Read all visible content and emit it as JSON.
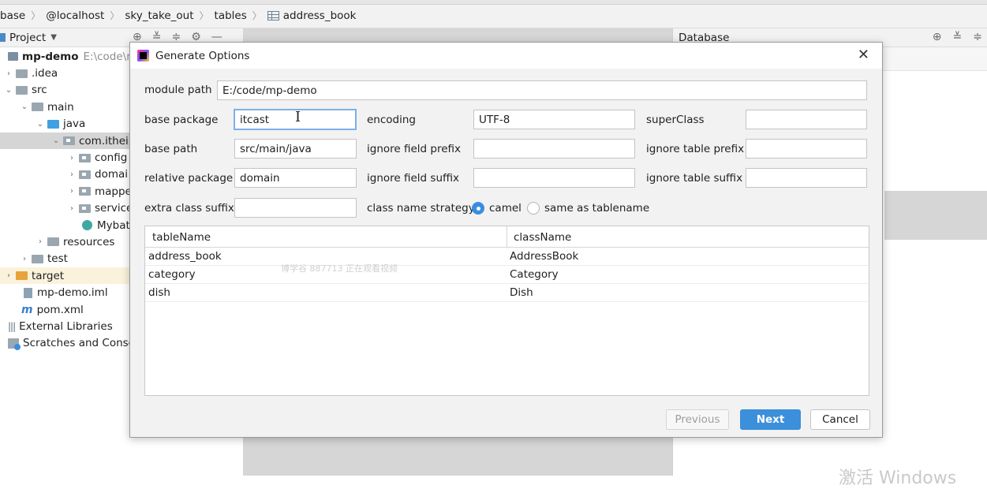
{
  "breadcrumb": {
    "items": [
      "base",
      "@localhost",
      "sky_take_out",
      "tables",
      "address_book"
    ]
  },
  "project_panel": {
    "title": "Project",
    "tree": [
      {
        "label": "mp-demo",
        "path": "E:\\code\\m",
        "level": 0,
        "arrow": "down"
      },
      {
        "label": ".idea",
        "level": 1,
        "arrow": "right"
      },
      {
        "label": "src",
        "level": 1,
        "arrow": "down"
      },
      {
        "label": "main",
        "level": 2,
        "arrow": "down"
      },
      {
        "label": "java",
        "level": 3,
        "arrow": "down"
      },
      {
        "label": "com.itheim",
        "level": 4,
        "arrow": "down"
      },
      {
        "label": "config",
        "level": 5,
        "arrow": "right"
      },
      {
        "label": "domai",
        "level": 5,
        "arrow": "right"
      },
      {
        "label": "mappe",
        "level": 5,
        "arrow": "right"
      },
      {
        "label": "service",
        "level": 5,
        "arrow": "right"
      },
      {
        "label": "Mybat",
        "level": 5,
        "arrow": ""
      },
      {
        "label": "resources",
        "level": 3,
        "arrow": "right"
      },
      {
        "label": "test",
        "level": 2,
        "arrow": "right"
      },
      {
        "label": "target",
        "level": 1,
        "arrow": "right"
      },
      {
        "label": "mp-demo.iml",
        "level": 1,
        "arrow": ""
      },
      {
        "label": "pom.xml",
        "level": 1,
        "arrow": ""
      },
      {
        "label": "External Libraries",
        "level": 0,
        "arrow": ""
      },
      {
        "label": "Scratches and Console",
        "level": 0,
        "arrow": ""
      }
    ]
  },
  "database_panel": {
    "title": "Database",
    "os_watermark": "激活 Windows"
  },
  "dialog": {
    "title": "Generate Options",
    "module_path_label": "module path",
    "module_path_value": "E:/code/mp-demo",
    "base_package_label": "base package",
    "base_package_value": "itcast",
    "encoding_label": "encoding",
    "encoding_value": "UTF-8",
    "super_class_label": "superClass",
    "super_class_value": "",
    "base_path_label": "base path",
    "base_path_value": "src/main/java",
    "ignore_field_prefix_label": "ignore field prefix",
    "ignore_field_prefix_value": "",
    "ignore_table_prefix_label": "ignore table prefix",
    "ignore_table_prefix_value": "",
    "relative_package_label": "relative package",
    "relative_package_value": "domain",
    "ignore_field_suffix_label": "ignore field suffix",
    "ignore_field_suffix_value": "",
    "ignore_table_suffix_label": "ignore table suffix",
    "ignore_table_suffix_value": "",
    "extra_class_suffix_label": "extra class suffix",
    "extra_class_suffix_value": "",
    "strategy_label": "class name strategy",
    "strategy_options": [
      "camel",
      "same as tablename"
    ],
    "strategy_selected": "camel",
    "table": {
      "columns": [
        "tableName",
        "className"
      ],
      "rows": [
        [
          "address_book",
          "AddressBook"
        ],
        [
          "category",
          "Category"
        ],
        [
          "dish",
          "Dish"
        ]
      ],
      "watermark": "博学谷 887713 正在观看视频"
    },
    "buttons": {
      "previous": "Previous",
      "next": "Next",
      "cancel": "Cancel"
    }
  },
  "colors": {
    "accent": "#3c8fdb",
    "selection": "#d5d5d5",
    "target_highlight": "#fbf2dc"
  }
}
